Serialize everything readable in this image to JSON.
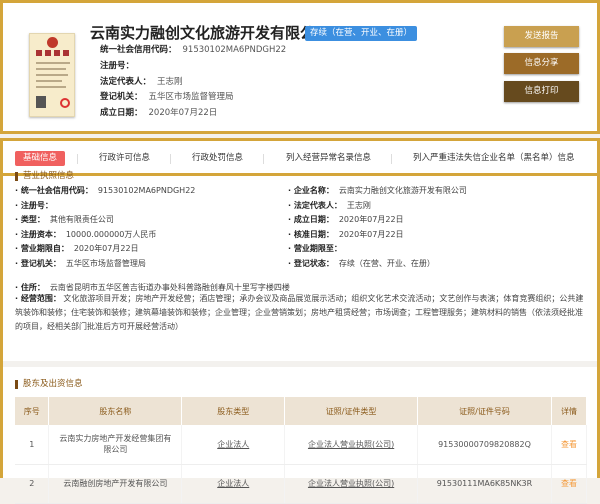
{
  "company": {
    "name": "云南实力融创文化旅游开发有限公司",
    "status_badge": "存续（在营、开业、在册）",
    "license_image_text": "营业执照",
    "fields": [
      {
        "label": "统一社会信用代码：",
        "value": "91530102MA6PNDGH22"
      },
      {
        "label": "注册号：",
        "value": ""
      },
      {
        "label": "法定代表人：",
        "value": "王志刚"
      },
      {
        "label": "登记机关：",
        "value": "五华区市场监督管理局"
      },
      {
        "label": "成立日期：",
        "value": "2020年07月22日"
      }
    ]
  },
  "buttons": {
    "send_report": "发送报告",
    "share": "信息分享",
    "print": "信息打印"
  },
  "colors": {
    "border": "#d4a53a",
    "badge": "#3c8fe0",
    "active_tab": "#f0605f",
    "btn1": "#c9a050",
    "btn2": "#9c6b28",
    "btn3": "#664a1e"
  },
  "tabs": [
    "基础信息",
    "行政许可信息",
    "行政处罚信息",
    "列入经营异常名录信息",
    "列入严重违法失信企业名单（黑名单）信息"
  ],
  "license_section": {
    "title": "营业执照信息",
    "left": [
      {
        "label": "统一社会信用代码：",
        "value": "91530102MA6PNDGH22"
      },
      {
        "label": "注册号：",
        "value": ""
      },
      {
        "label": "类型：",
        "value": "其他有限责任公司"
      },
      {
        "label": "注册资本：",
        "value": "10000.000000万人民币"
      },
      {
        "label": "营业期限自：",
        "value": "2020年07月22日"
      },
      {
        "label": "登记机关：",
        "value": "五华区市场监督管理局"
      }
    ],
    "right": [
      {
        "label": "企业名称：",
        "value": "云南实力融创文化旅游开发有限公司"
      },
      {
        "label": "法定代表人：",
        "value": "王志刚"
      },
      {
        "label": "成立日期：",
        "value": "2020年07月22日"
      },
      {
        "label": "核准日期：",
        "value": "2020年07月22日"
      },
      {
        "label": "营业期限至：",
        "value": ""
      },
      {
        "label": "登记状态：",
        "value": "存续（在营、开业、在册）"
      }
    ],
    "address": {
      "label": "住所：",
      "value": "云南省昆明市五华区普吉街道办事处科普路融创春风十里写字楼四楼"
    },
    "scope": {
      "label": "经营范围：",
      "value": "文化旅游项目开发；房地产开发经营；酒店管理；承办会议及商品展览展示活动；组织文化艺术交流活动；文艺创作与表演；体育竞赛组织；公共建筑装饰和装修；住宅装饰和装修；建筑幕墙装饰和装修；企业管理；企业营销策划；房地产租赁经营；市场调查；工程管理服务；建筑材料的销售（依法须经批准的项目，经相关部门批准后方可开展经营活动）"
    }
  },
  "shareholders": {
    "title": "股东及出资信息",
    "headers": [
      "序号",
      "股东名称",
      "股东类型",
      "证照/证件类型",
      "证照/证件号码",
      "详情"
    ],
    "rows": [
      {
        "no": "1",
        "name": "云南实力房地产开发经营集团有限公司",
        "type": "企业法人",
        "cert_type": "企业法人营业执照(公司)",
        "cert_no": "91530000709820882Q",
        "detail": "查看"
      },
      {
        "no": "2",
        "name": "云南融创房地产开发有限公司",
        "type": "企业法人",
        "cert_type": "企业法人营业执照(公司)",
        "cert_no": "91530111MA6K85NK3R",
        "detail": "查看"
      }
    ]
  }
}
